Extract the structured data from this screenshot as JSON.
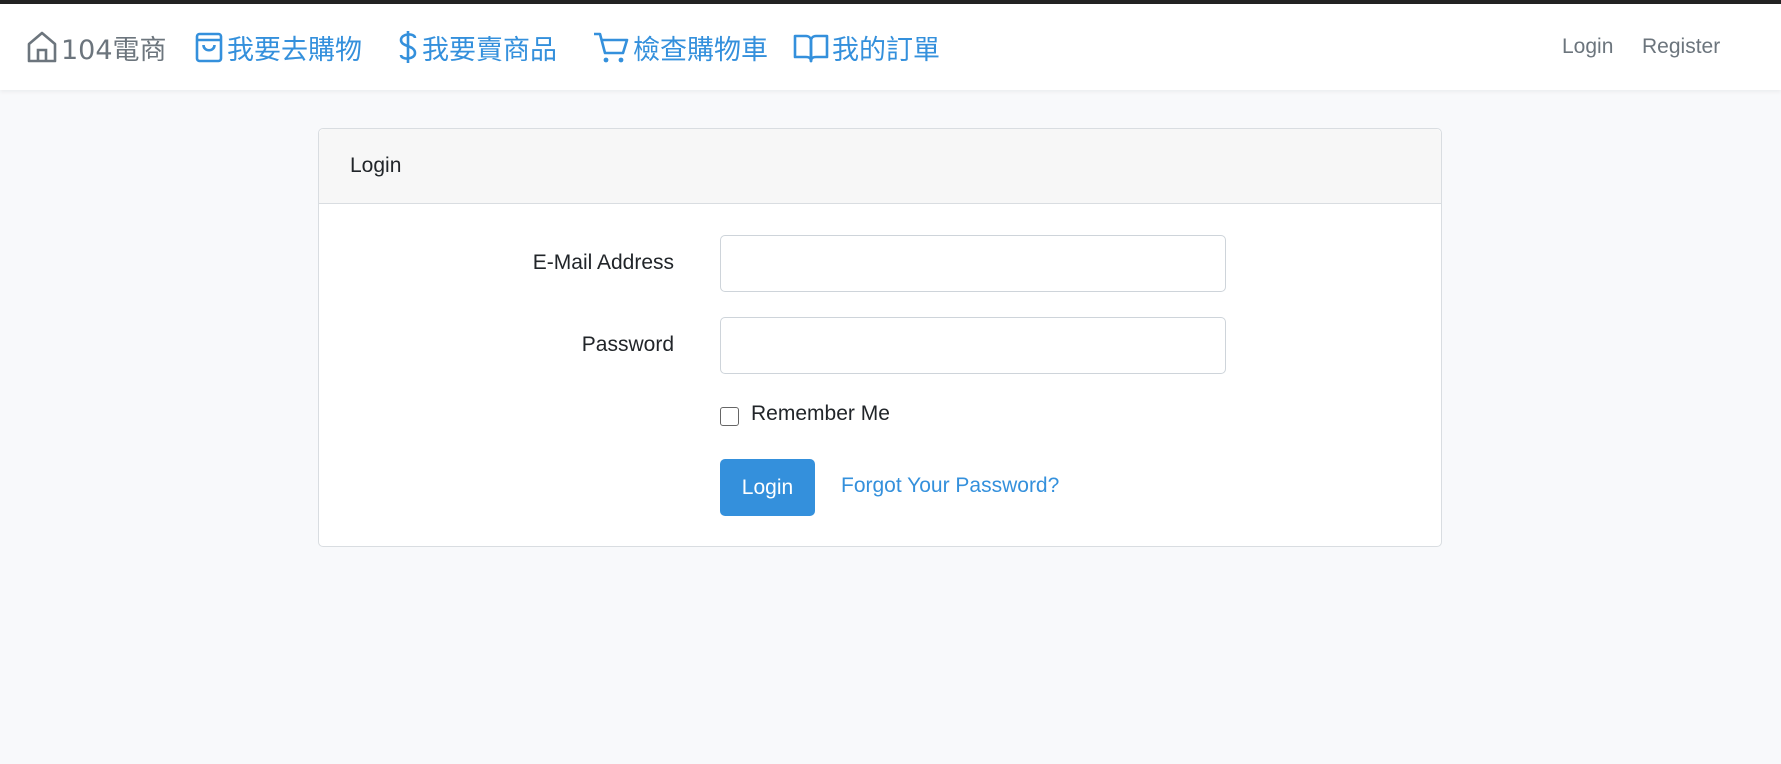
{
  "navbar": {
    "brand": {
      "label": "104電商",
      "icon": "home-icon"
    },
    "links": [
      {
        "label": "我要去購物",
        "icon": "shopping-bag-icon"
      },
      {
        "label": "我要賣商品",
        "icon": "dollar-icon"
      },
      {
        "label": "檢查購物車",
        "icon": "cart-icon"
      },
      {
        "label": "我的訂單",
        "icon": "book-icon"
      }
    ],
    "login_label": "Login",
    "register_label": "Register"
  },
  "card": {
    "header": "Login",
    "email_label": "E-Mail Address",
    "email_value": "",
    "password_label": "Password",
    "password_value": "",
    "remember_label": "Remember Me",
    "remember_checked": false,
    "submit_label": "Login",
    "forgot_label": "Forgot Your Password?"
  },
  "colors": {
    "accent": "#3490dc",
    "nav_muted": "#6c757d",
    "background": "#f8f9fb"
  }
}
